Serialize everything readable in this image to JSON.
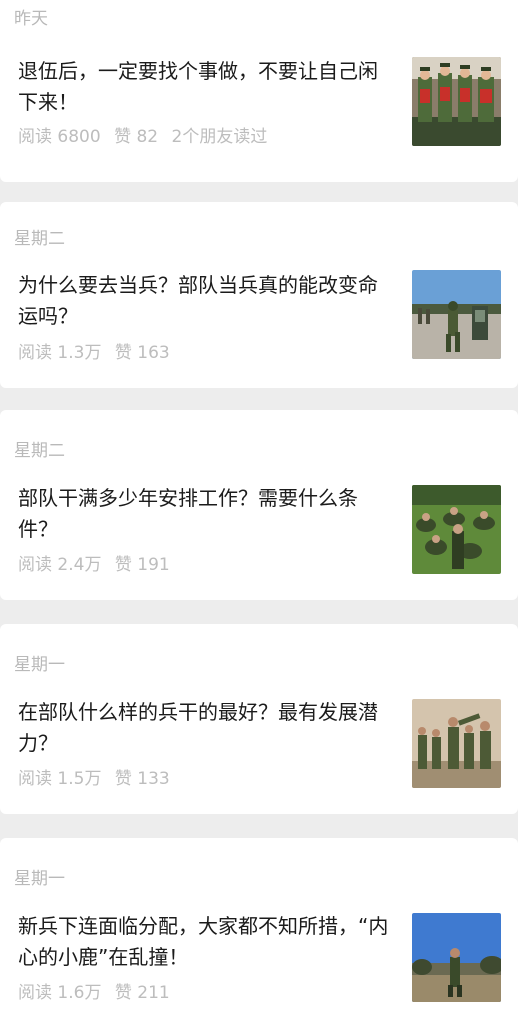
{
  "articles": [
    {
      "date": "昨天",
      "title": "退伍后，一定要找个事做，不要让自己闲下来！",
      "reads": "阅读 6800",
      "likes": "赞 82",
      "friends": "2个朋友读过",
      "thumb_icon": "honor-guard-photo"
    },
    {
      "date": "星期二",
      "title": "为什么要去当兵？部队当兵真的能改变命运吗？",
      "reads": "阅读 1.3万",
      "likes": "赞 163",
      "thumb_icon": "soldier-training-photo"
    },
    {
      "date": "星期二",
      "title": "部队干满多少年安排工作？需要什么条件？",
      "reads": "阅读 2.4万",
      "likes": "赞 191",
      "thumb_icon": "soldiers-on-grass-photo"
    },
    {
      "date": "星期一",
      "title": "在部队什么样的兵干的最好？最有发展潜力？",
      "reads": "阅读 1.5万",
      "likes": "赞 133",
      "thumb_icon": "combat-drill-photo"
    },
    {
      "date": "星期一",
      "title": "新兵下连面临分配，大家都不知所措，“内心的小鹿”在乱撞！",
      "reads": "阅读 1.6万",
      "likes": "赞 211",
      "thumb_icon": "soldier-under-sky-photo"
    }
  ]
}
